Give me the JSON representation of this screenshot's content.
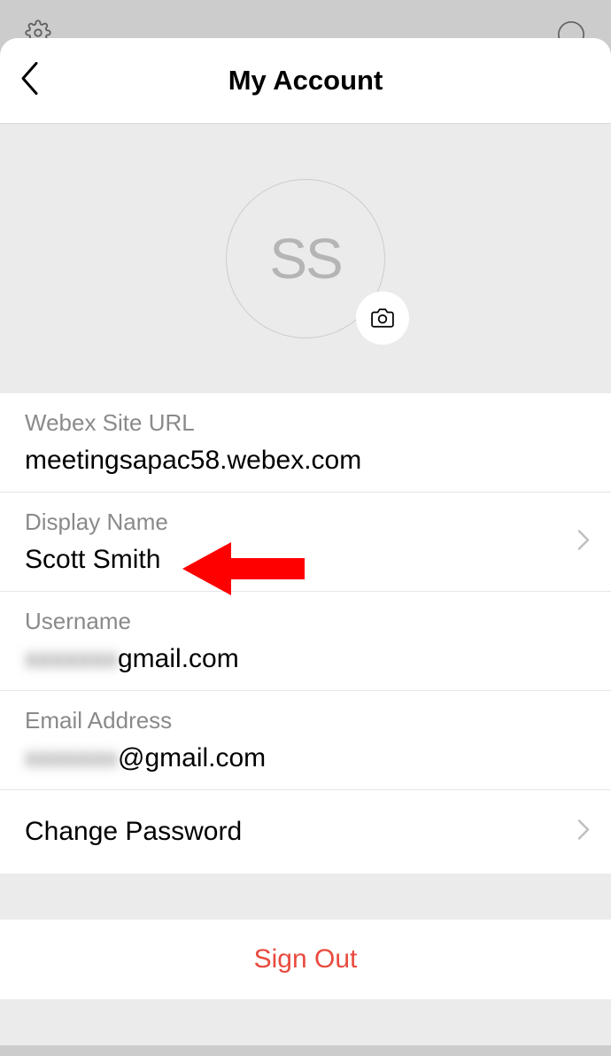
{
  "header": {
    "title": "My Account"
  },
  "avatar": {
    "initials": "SS"
  },
  "fields": {
    "site_url_label": "Webex Site URL",
    "site_url_value": "meetingsapac58.webex.com",
    "display_name_label": "Display Name",
    "display_name_value": "Scott Smith",
    "username_label": "Username",
    "username_blurred_prefix": "xxxxxxx",
    "username_suffix": "gmail.com",
    "email_label": "Email Address",
    "email_blurred_prefix": "xxxxxxx",
    "email_suffix": "@gmail.com",
    "change_password_label": "Change Password"
  },
  "sign_out_label": "Sign Out"
}
